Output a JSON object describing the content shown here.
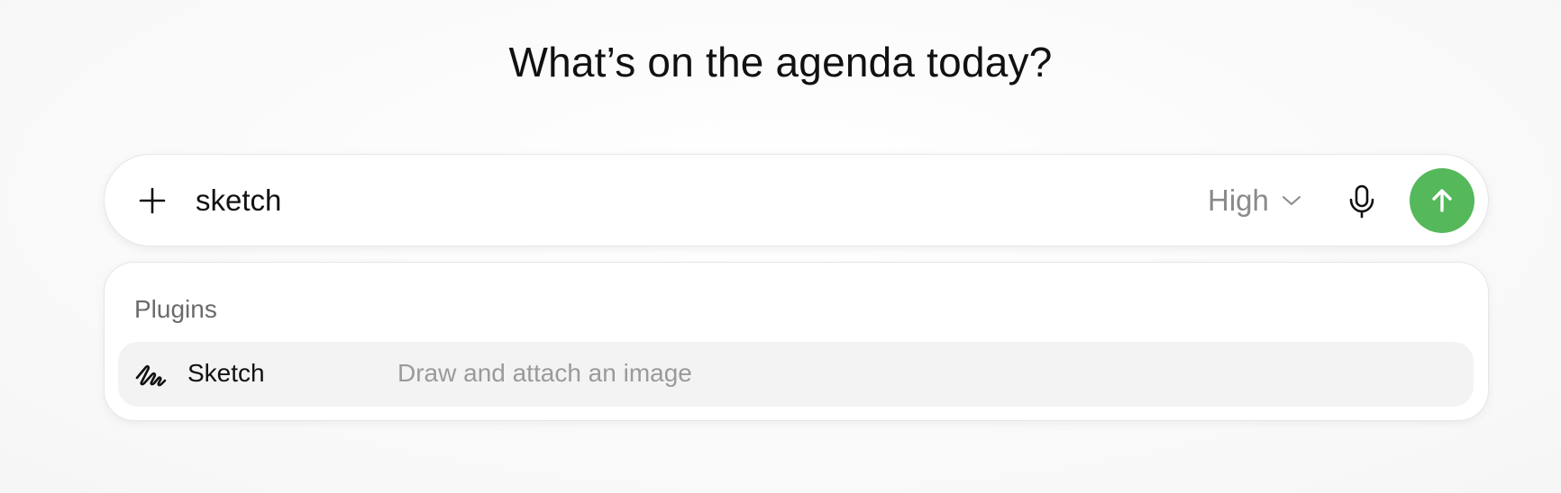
{
  "headline": "What’s on the agenda today?",
  "composer": {
    "input_value": "sketch",
    "level_label": "High",
    "icons": {
      "add": "plus-icon",
      "level_dropdown": "chevron-down-icon",
      "voice": "microphone-icon",
      "send": "arrow-up-icon"
    },
    "send_button_color": "#55b85b"
  },
  "suggestions": {
    "section_label": "Plugins",
    "items": [
      {
        "name": "Sketch",
        "description": "Draw and attach an image",
        "icon": "sketch-squiggle-icon"
      }
    ]
  }
}
